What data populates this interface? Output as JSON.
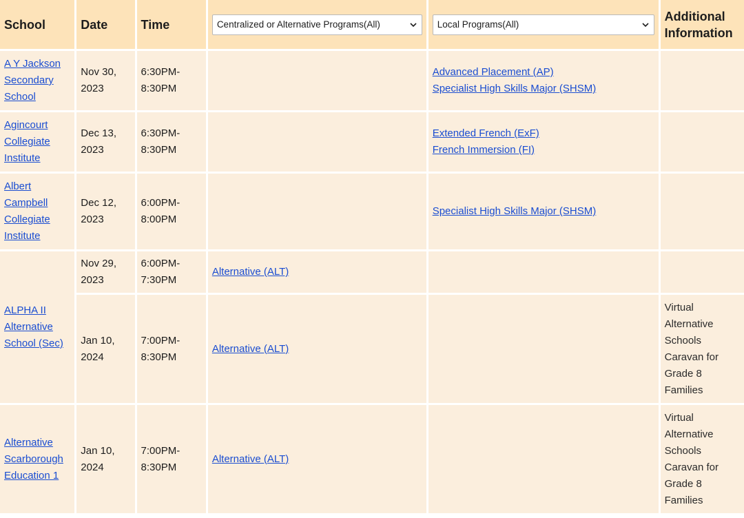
{
  "header": {
    "school": "School",
    "date": "Date",
    "time": "Time",
    "centralized_filter": "Centralized or Alternative Programs(All)",
    "local_filter": "Local Programs(All)",
    "additional": "Additional Information"
  },
  "rows": [
    {
      "school": "A Y Jackson Secondary School",
      "date": "Nov 30, 2023",
      "time": "6:30PM-8:30PM",
      "central": "",
      "local": [
        "Advanced Placement (AP)",
        "Specialist High Skills Major (SHSM)"
      ],
      "info": ""
    },
    {
      "school": "Agincourt Collegiate Institute",
      "date": "Dec 13, 2023",
      "time": "6:30PM-8:30PM",
      "central": "",
      "local": [
        "Extended French (ExF)",
        "French Immersion (FI)"
      ],
      "info": ""
    },
    {
      "school": "Albert Campbell Collegiate Institute",
      "date": "Dec 12, 2023",
      "time": "6:00PM-8:00PM",
      "central": "",
      "local": [
        "Specialist High Skills Major (SHSM)"
      ],
      "info": ""
    },
    {
      "school": "ALPHA II Alternative School (Sec)",
      "date": "Nov 29, 2023",
      "time": "6:00PM-7:30PM",
      "central": "Alternative (ALT)",
      "local": [],
      "info": ""
    },
    {
      "school": "",
      "date": "Jan 10, 2024",
      "time": "7:00PM-8:30PM",
      "central": "Alternative (ALT)",
      "local": [],
      "info": "Virtual Alternative Schools Caravan for Grade 8 Families"
    },
    {
      "school": "Alternative Scarborough Education 1",
      "date": "Jan 10, 2024",
      "time": "7:00PM-8:30PM",
      "central": "Alternative (ALT)",
      "local": [],
      "info": "Virtual Alternative Schools Caravan for Grade 8 Families"
    }
  ]
}
